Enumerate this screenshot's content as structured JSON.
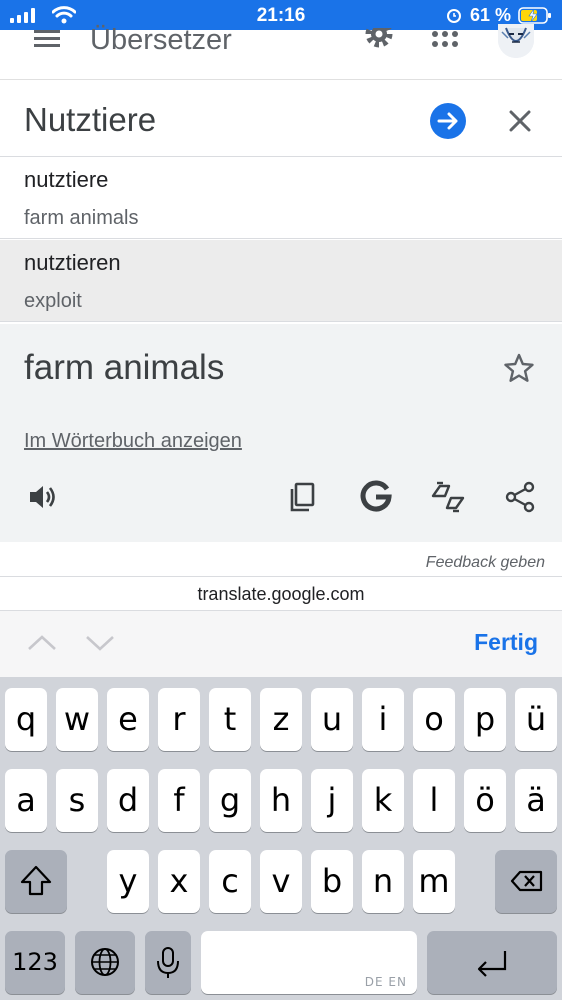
{
  "status_bar": {
    "time": "21:16",
    "battery_percent": "61 %"
  },
  "app_bar": {
    "title": "Übersetzer"
  },
  "search": {
    "value": "Nutztiere"
  },
  "suggestions": [
    {
      "term": "nutztiere",
      "translation": "farm animals"
    },
    {
      "term": "nutztieren",
      "translation": "exploit"
    }
  ],
  "result": {
    "text": "farm animals",
    "dictionary_link": "Im Wörterbuch anzeigen",
    "icons": [
      "speaker-icon",
      "copy-icon",
      "google-icon",
      "swap-icon",
      "share-icon"
    ]
  },
  "feedback_label": "Feedback geben",
  "url": "translate.google.com",
  "accessory": {
    "done_label": "Fertig"
  },
  "keyboard": {
    "row1": [
      "q",
      "w",
      "e",
      "r",
      "t",
      "z",
      "u",
      "i",
      "o",
      "p",
      "ü"
    ],
    "row2": [
      "a",
      "s",
      "d",
      "f",
      "g",
      "h",
      "j",
      "k",
      "l",
      "ö",
      "ä"
    ],
    "row3": [
      "y",
      "x",
      "c",
      "v",
      "b",
      "n",
      "m"
    ],
    "numbers_label": "123",
    "language_hint": "DE EN"
  },
  "colors": {
    "accent": "#1a73e8",
    "card_bg": "#f1f3f4",
    "keyboard_bg": "#d1d4da"
  }
}
